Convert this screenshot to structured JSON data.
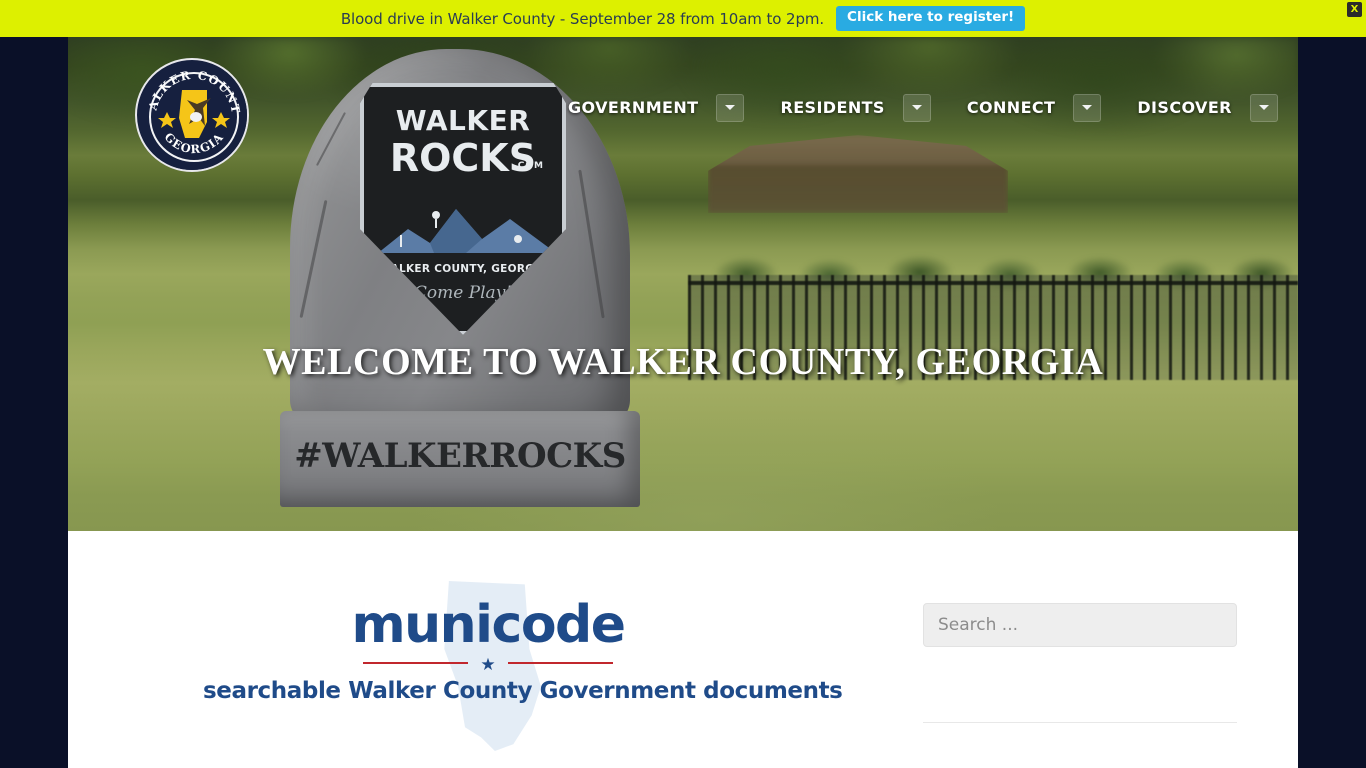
{
  "alert": {
    "message": "Blood drive in Walker County - September 28 from 10am to 2pm.",
    "cta_label": "Click here to register!",
    "close_label": "X",
    "background_color": "#ddf000",
    "cta_color": "#29abe2"
  },
  "header": {
    "logo": {
      "top_arc": "WALKER COUNTY",
      "bottom_arc": "GEORGIA",
      "alt": "walker-county-georgia-seal"
    },
    "nav": [
      {
        "label": "GOVERNMENT",
        "has_dropdown": true
      },
      {
        "label": "RESIDENTS",
        "has_dropdown": true
      },
      {
        "label": "CONNECT",
        "has_dropdown": true
      },
      {
        "label": "DISCOVER",
        "has_dropdown": true
      }
    ]
  },
  "hero": {
    "heading": "WELCOME TO WALKER COUNTY, GEORGIA",
    "monument": {
      "shield_line1": "WALKER",
      "shield_line2": "ROCKS",
      "shield_domain": ".COM",
      "shield_county": "WALKER COUNTY, GEORGIA",
      "shield_tagline": "Come Play!",
      "pedestal_text": "#WALKERROCKS"
    }
  },
  "main": {
    "municode": {
      "wordmark": "municode",
      "star": "★",
      "caption": "searchable Walker County Government documents",
      "brand_color": "#1f4b89",
      "rule_color": "#c1272d"
    }
  },
  "sidebar": {
    "search": {
      "value": "",
      "placeholder": "Search ..."
    }
  },
  "page": {
    "background_color": "#0a1028",
    "content_background": "#ffffff"
  }
}
